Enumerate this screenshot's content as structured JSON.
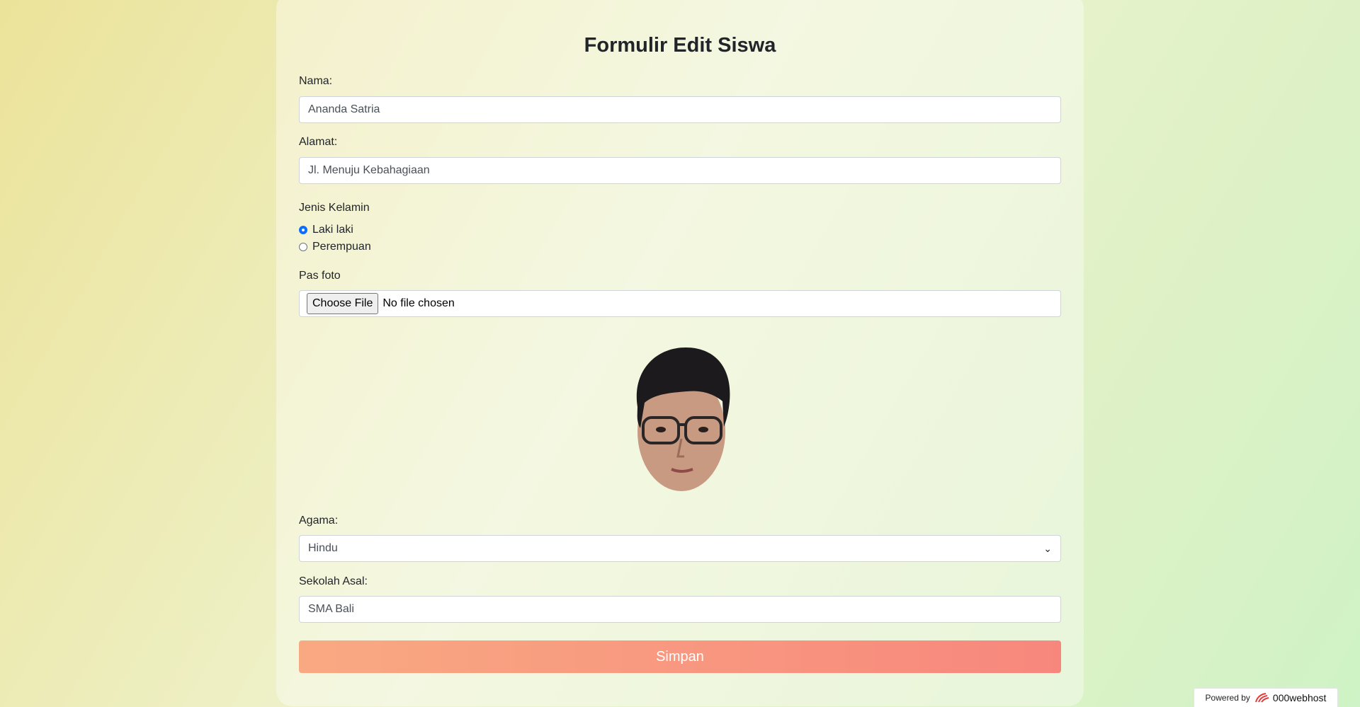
{
  "form": {
    "title": "Formulir Edit Siswa",
    "nama_label": "Nama:",
    "nama_value": "Ananda Satria",
    "alamat_label": "Alamat:",
    "alamat_value": "Jl. Menuju Kebahagiaan",
    "gender_label": "Jenis Kelamin",
    "gender_options": [
      "Laki laki",
      "Perempuan"
    ],
    "gender_selected": "Laki laki",
    "photo_label": "Pas foto",
    "file_button": "Choose File",
    "file_status": "No file chosen",
    "agama_label": "Agama:",
    "agama_value": "Hindu",
    "sekolah_label": "Sekolah Asal:",
    "sekolah_value": "SMA Bali",
    "submit_label": "Simpan"
  },
  "footer": {
    "powered_label": "Powered by",
    "brand": "000webhost"
  },
  "colors": {
    "accent_radio": "#0d6efd",
    "button_start": "#f9a982",
    "button_end": "#f7877d"
  },
  "icons": {
    "select": "chevron-down-icon",
    "brand": "000webhost-logo-icon"
  }
}
